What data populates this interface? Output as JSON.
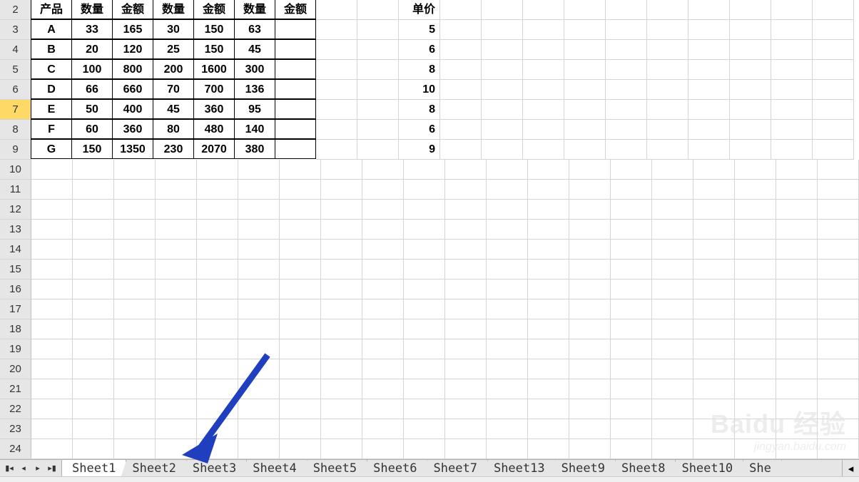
{
  "row_numbers": [
    2,
    3,
    4,
    5,
    6,
    7,
    8,
    9,
    10,
    11,
    12,
    13,
    14,
    15,
    16,
    17,
    18,
    19,
    20,
    21,
    22,
    23,
    24
  ],
  "selected_row": 7,
  "headers": {
    "r2": [
      "产品",
      "数量",
      "金额",
      "数量",
      "金额",
      "数量",
      "金额",
      "",
      "",
      "单价"
    ]
  },
  "data_rows": [
    {
      "p": "A",
      "c": [
        "33",
        "165",
        "30",
        "150",
        "63",
        ""
      ],
      "price": "5"
    },
    {
      "p": "B",
      "c": [
        "20",
        "120",
        "25",
        "150",
        "45",
        ""
      ],
      "price": "6"
    },
    {
      "p": "C",
      "c": [
        "100",
        "800",
        "200",
        "1600",
        "300",
        ""
      ],
      "price": "8"
    },
    {
      "p": "D",
      "c": [
        "66",
        "660",
        "70",
        "700",
        "136",
        ""
      ],
      "price": "10"
    },
    {
      "p": "E",
      "c": [
        "50",
        "400",
        "45",
        "360",
        "95",
        ""
      ],
      "price": "8"
    },
    {
      "p": "F",
      "c": [
        "60",
        "360",
        "80",
        "480",
        "140",
        ""
      ],
      "price": "6"
    },
    {
      "p": "G",
      "c": [
        "150",
        "1350",
        "230",
        "2070",
        "380",
        ""
      ],
      "price": "9"
    }
  ],
  "sheet_tabs": [
    "Sheet1",
    "Sheet2",
    "Sheet3",
    "Sheet4",
    "Sheet5",
    "Sheet6",
    "Sheet7",
    "Sheet13",
    "Sheet9",
    "Sheet8",
    "Sheet10",
    "She"
  ],
  "active_tab": 0,
  "watermark": {
    "line1": "Baidu 经验",
    "line2": "jingyan.baidu.com"
  },
  "chart_data": {
    "type": "table",
    "title": "",
    "columns": [
      "产品",
      "数量",
      "金额",
      "数量",
      "金额",
      "数量",
      "金额",
      "单价"
    ],
    "rows": [
      [
        "A",
        33,
        165,
        30,
        150,
        63,
        null,
        5
      ],
      [
        "B",
        20,
        120,
        25,
        150,
        45,
        null,
        6
      ],
      [
        "C",
        100,
        800,
        200,
        1600,
        300,
        null,
        8
      ],
      [
        "D",
        66,
        660,
        70,
        700,
        136,
        null,
        10
      ],
      [
        "E",
        50,
        400,
        45,
        360,
        95,
        null,
        8
      ],
      [
        "F",
        60,
        360,
        80,
        480,
        140,
        null,
        6
      ],
      [
        "G",
        150,
        1350,
        230,
        2070,
        380,
        null,
        9
      ]
    ]
  }
}
